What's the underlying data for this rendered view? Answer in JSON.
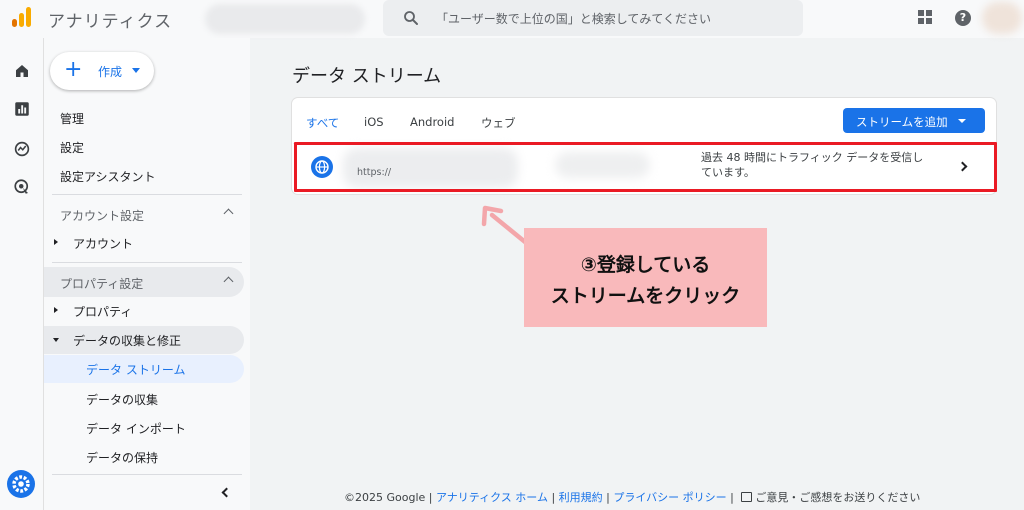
{
  "app": {
    "title": "アナリティクス",
    "search_placeholder": "「ユーザー数で上位の国」と検索してみてください",
    "help_glyph": "?"
  },
  "nav": {
    "create_label": "作成",
    "top_items": [
      "管理",
      "設定",
      "設定アシスタント"
    ],
    "account_section": {
      "label": "アカウント設定",
      "item": "アカウント"
    },
    "property_section": {
      "label": "プロパティ設定",
      "property_item": "プロパティ",
      "data_collection_item": "データの収集と修正",
      "sub_items": [
        "データ ストリーム",
        "データの収集",
        "データ インポート",
        "データの保持"
      ]
    }
  },
  "main": {
    "page_title": "データ ストリーム",
    "tabs": [
      "すべて",
      "iOS",
      "Android",
      "ウェブ"
    ],
    "active_tab": "すべて",
    "add_stream_label": "ストリームを追加",
    "stream": {
      "url": "https://",
      "status_line1": "過去 48 時間にトラフィック データを受信し",
      "status_line2": "ています。"
    }
  },
  "annotation": {
    "line1": "③登録している",
    "line2": "ストリームをクリック"
  },
  "footer": {
    "copyright": "©2025 Google",
    "links": [
      "アナリティクス ホーム",
      "利用規約",
      "プライバシー ポリシー"
    ],
    "feedback": "ご意見・ご感想をお送りください"
  },
  "colors": {
    "accent": "#1a73e8",
    "highlight_border": "#ea1a24",
    "callout_bg": "#f9b9bb"
  }
}
